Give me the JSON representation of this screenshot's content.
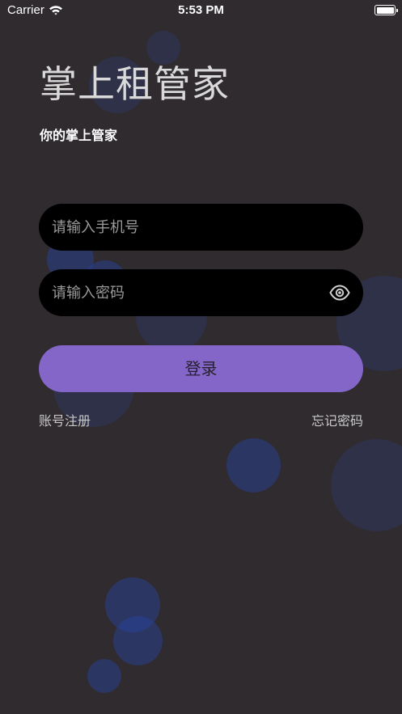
{
  "status_bar": {
    "carrier": "Carrier",
    "time": "5:53 PM"
  },
  "header": {
    "title": "掌上租管家",
    "subtitle": "你的掌上管家"
  },
  "form": {
    "phone_placeholder": "请输入手机号",
    "password_placeholder": "请输入密码",
    "login_label": "登录"
  },
  "links": {
    "register": "账号注册",
    "forgot_password": "忘记密码"
  },
  "colors": {
    "background": "#2f2b2f",
    "accent": "#8466c8",
    "input_background": "#000000"
  },
  "icons": {
    "password_visibility": "eye-icon",
    "wifi": "wifi-icon",
    "battery": "battery-icon"
  }
}
